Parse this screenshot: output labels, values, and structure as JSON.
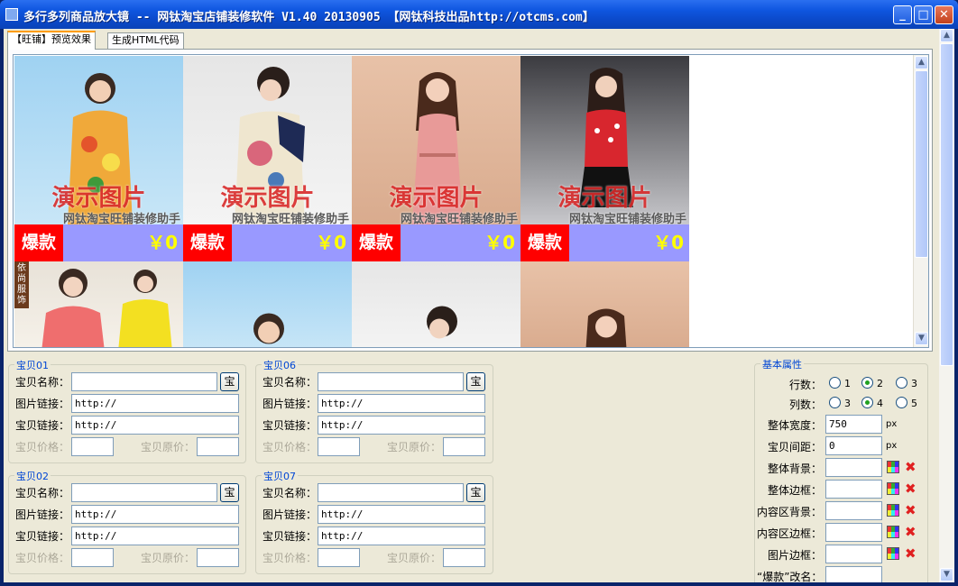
{
  "window": {
    "title": "多行多列商品放大镜 -- 网钛淘宝店铺装修软件 V1.40 20130905 【网钛科技出品http://otcms.com】"
  },
  "tabs": [
    {
      "label": "【旺铺】预览效果"
    },
    {
      "label": "生成HTML代码"
    }
  ],
  "preview": {
    "watermark_main": "演示图片",
    "watermark_sub": "网钛淘宝旺铺装修助手",
    "hot_label": "爆款",
    "price": "￥0",
    "row2_banner": "依尚服饰"
  },
  "items": [
    {
      "legend": "宝贝01",
      "name_label": "宝贝名称：",
      "pick_label": "宝",
      "img_label": "图片链接：",
      "img_value": "http://",
      "link_label": "宝贝链接：",
      "link_value": "http://",
      "price_label": "宝贝价格：",
      "orig_label": "宝贝原价："
    },
    {
      "legend": "宝贝06",
      "name_label": "宝贝名称：",
      "pick_label": "宝",
      "img_label": "图片链接：",
      "img_value": "http://",
      "link_label": "宝贝链接：",
      "link_value": "http://",
      "price_label": "宝贝价格：",
      "orig_label": "宝贝原价："
    },
    {
      "legend": "宝贝02",
      "name_label": "宝贝名称：",
      "pick_label": "宝",
      "img_label": "图片链接：",
      "img_value": "http://",
      "link_label": "宝贝链接：",
      "link_value": "http://",
      "price_label": "宝贝价格：",
      "orig_label": "宝贝原价："
    },
    {
      "legend": "宝贝07",
      "name_label": "宝贝名称：",
      "pick_label": "宝",
      "img_label": "图片链接：",
      "img_value": "http://",
      "link_label": "宝贝链接：",
      "link_value": "http://",
      "price_label": "宝贝价格：",
      "orig_label": "宝贝原价："
    }
  ],
  "props": {
    "legend": "基本属性",
    "rows_label": "行数：",
    "rows_options": [
      "1",
      "2",
      "3"
    ],
    "rows_selected": "2",
    "cols_label": "列数：",
    "cols_options": [
      "3",
      "4",
      "5"
    ],
    "cols_selected": "4",
    "width_label": "整体宽度：",
    "width_value": "750",
    "width_unit": "px",
    "gap_label": "宝贝间距：",
    "gap_value": "0",
    "gap_unit": "px",
    "bg_label": "整体背景：",
    "border_label": "整体边框：",
    "content_bg_label": "内容区背景：",
    "content_border_label": "内容区边框：",
    "img_border_label": "图片边框：",
    "rename_label": "“爆款”改名："
  },
  "colors": {
    "hot_bg": "#ff0000",
    "bar_bg": "#9999ff",
    "price": "#ffff00",
    "legend": "#0046d5"
  }
}
